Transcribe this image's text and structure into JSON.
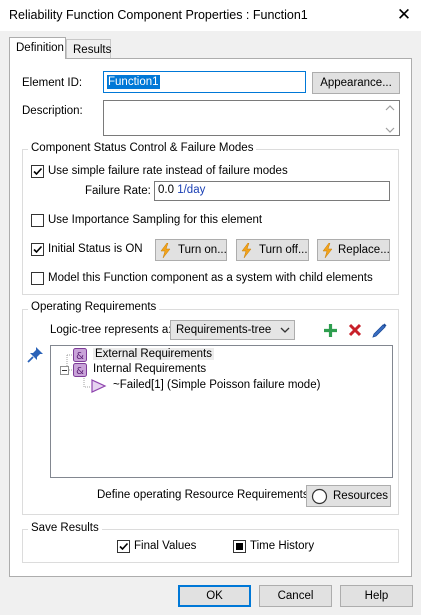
{
  "window": {
    "title": "Reliability Function Component Properties : Function1",
    "close_glyph": "✕"
  },
  "tabs": [
    {
      "label": "Definition"
    },
    {
      "label": "Results"
    }
  ],
  "definition": {
    "element_id_label": "Element ID:",
    "element_id_value": "Function1",
    "appearance_button": "Appearance...",
    "description_label": "Description:",
    "description_value": ""
  },
  "status_group": {
    "title": "Component Status Control & Failure Modes",
    "simple_failure_rate": {
      "label": "Use simple failure rate instead of failure modes",
      "checked": true
    },
    "failure_rate_label": "Failure Rate:",
    "failure_rate_number": "0.0",
    "failure_rate_unit": "1/day",
    "importance_sampling": {
      "label": "Use Importance Sampling for this element",
      "checked": false
    },
    "initial_status": {
      "label": "Initial Status is ON",
      "checked": true
    },
    "turn_on_button": "Turn on...",
    "turn_off_button": "Turn off...",
    "replace_button": "Replace...",
    "model_system": {
      "label": "Model this Function component as a system with child elements",
      "checked": false
    }
  },
  "operating_group": {
    "title": "Operating Requirements",
    "logic_tree_label": "Logic-tree represents a:",
    "logic_tree_selected": "Requirements-tree",
    "tree": {
      "external": "External Requirements",
      "internal": "Internal Requirements",
      "child": "~Failed[1]  (Simple Poisson failure mode)"
    },
    "resource_label": "Define operating Resource Requirements:",
    "resources_button": "Resources"
  },
  "save_group": {
    "title": "Save Results",
    "final_values": {
      "label": "Final Values",
      "checked": true
    },
    "time_history": {
      "label": "Time History",
      "checked": true
    }
  },
  "footer": {
    "ok": "OK",
    "cancel": "Cancel",
    "help": "Help"
  },
  "colors": {
    "accent": "#0078d7",
    "blue_text": "#1a3fb4",
    "green_plus": "#2e9e4f",
    "red_x": "#c8202a",
    "logic_purple": "#9b59b6"
  },
  "icons": [
    "close-icon",
    "lightning-icon",
    "plus-icon",
    "delete-icon",
    "edit-pencil-icon",
    "pin-icon",
    "and-gate-icon",
    "collapse-icon",
    "condition-triangle-icon",
    "chevron-down-icon",
    "checkmark-icon",
    "radio-icon"
  ]
}
